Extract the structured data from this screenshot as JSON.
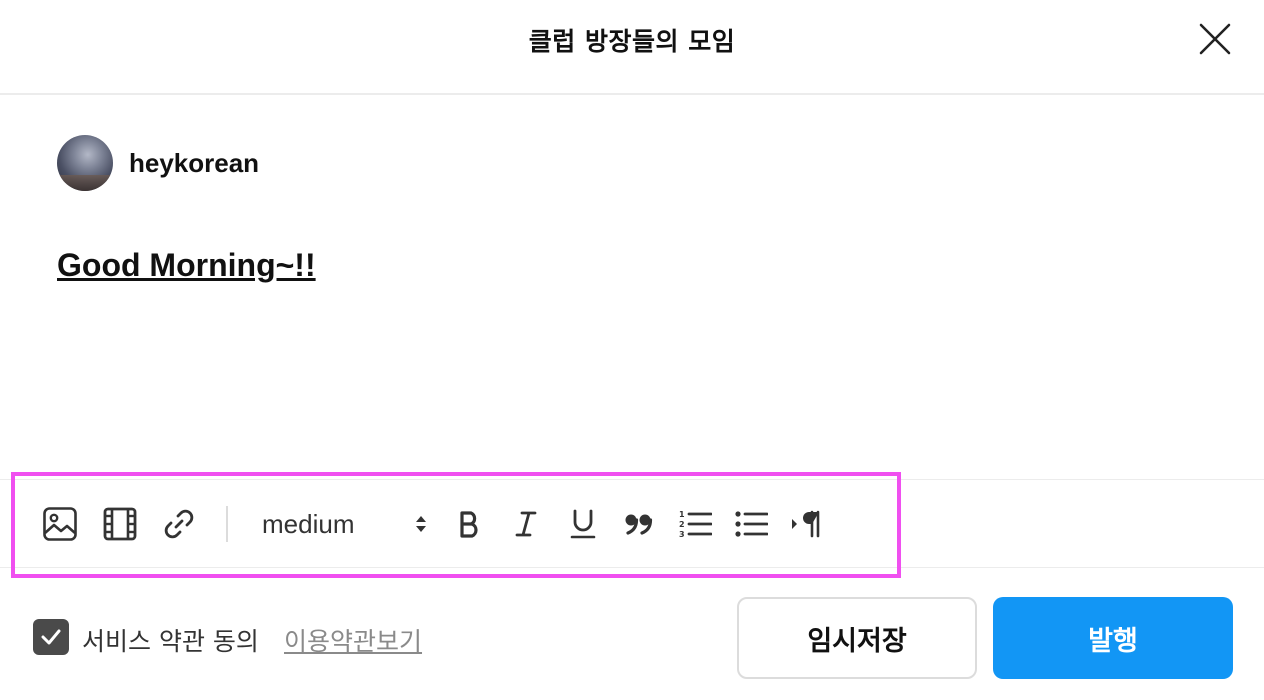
{
  "header": {
    "title": "클럽 방장들의 모임",
    "close_icon": "close-icon"
  },
  "author": {
    "name": "heykorean",
    "avatar_icon": "avatar"
  },
  "post": {
    "text": "Good Morning~!!"
  },
  "toolbar": {
    "font_size": "medium",
    "tools": [
      "image-icon",
      "video-icon",
      "link-icon",
      "bold-icon",
      "italic-icon",
      "underline-icon",
      "quote-icon",
      "ordered-list-icon",
      "bullet-list-icon",
      "paragraph-direction-icon"
    ]
  },
  "footer": {
    "agree_label": "서비스 약관 동의",
    "agree_checked": true,
    "terms_link": "이용약관보기",
    "draft_button": "임시저장",
    "publish_button": "발행"
  },
  "colors": {
    "accent": "#1296f5",
    "highlight": "#f04ff0",
    "checkbox": "#4a4a4a"
  }
}
